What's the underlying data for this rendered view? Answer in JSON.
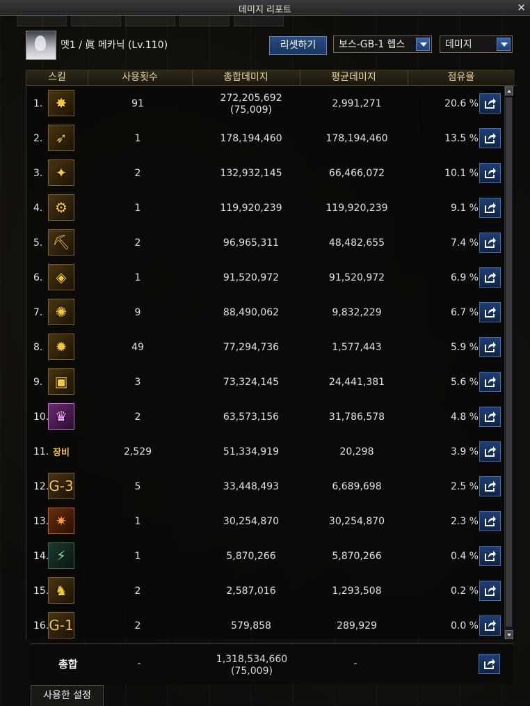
{
  "window": {
    "title": "데미지 리포트",
    "close_icon": "close-icon"
  },
  "header": {
    "character": "멧1 / 眞 메카닉 (Lv.110)",
    "reset_label": "리셋하기",
    "target_select": "보스-GB-1 헵스",
    "mode_select": "데미지"
  },
  "columns": [
    "스킬",
    "사용횟수",
    "총합데미지",
    "평균데미지",
    "점유율"
  ],
  "rows": [
    {
      "rank": "1.",
      "icon": "explosion-skill-icon",
      "uses": "91",
      "total": "272,205,692",
      "total_sub": "(75,009)",
      "avg": "2,991,271",
      "share": "20.6 %"
    },
    {
      "rank": "2.",
      "icon": "missile-skill-icon",
      "uses": "1",
      "total": "178,194,460",
      "total_sub": "",
      "avg": "178,194,460",
      "share": "13.5 %"
    },
    {
      "rank": "3.",
      "icon": "rocket-skill-icon",
      "uses": "2",
      "total": "132,932,145",
      "total_sub": "",
      "avg": "66,466,072",
      "share": "10.1 %"
    },
    {
      "rank": "4.",
      "icon": "mech-skill-icon",
      "uses": "1",
      "total": "119,920,239",
      "total_sub": "",
      "avg": "119,920,239",
      "share": "9.1 %"
    },
    {
      "rank": "5.",
      "icon": "drill-skill-icon",
      "uses": "2",
      "total": "96,965,311",
      "total_sub": "",
      "avg": "48,482,655",
      "share": "7.4 %"
    },
    {
      "rank": "6.",
      "icon": "robot-skill-icon",
      "uses": "1",
      "total": "91,520,972",
      "total_sub": "",
      "avg": "91,520,972",
      "share": "6.9 %"
    },
    {
      "rank": "7.",
      "icon": "burst-skill-icon",
      "uses": "9",
      "total": "88,490,062",
      "total_sub": "",
      "avg": "9,832,229",
      "share": "6.7 %"
    },
    {
      "rank": "8.",
      "icon": "blast-skill-icon",
      "uses": "49",
      "total": "77,294,736",
      "total_sub": "",
      "avg": "1,577,443",
      "share": "5.9 %"
    },
    {
      "rank": "9.",
      "icon": "turret-skill-icon",
      "uses": "3",
      "total": "73,324,145",
      "total_sub": "",
      "avg": "24,441,381",
      "share": "5.6 %"
    },
    {
      "rank": "10.",
      "icon": "laser-skill-icon",
      "uses": "2",
      "total": "63,573,156",
      "total_sub": "",
      "avg": "31,786,578",
      "share": "4.8 %"
    },
    {
      "rank": "11.",
      "icon": "equipment-text",
      "uses": "2,529",
      "total": "51,334,919",
      "total_sub": "",
      "avg": "20,298",
      "share": "3.9 %"
    },
    {
      "rank": "12.",
      "icon": "g3-skill-icon",
      "uses": "5",
      "total": "33,448,493",
      "total_sub": "",
      "avg": "6,689,698",
      "share": "2.5 %"
    },
    {
      "rank": "13.",
      "icon": "fire-skill-icon",
      "uses": "1",
      "total": "30,254,870",
      "total_sub": "",
      "avg": "30,254,870",
      "share": "2.3 %"
    },
    {
      "rank": "14.",
      "icon": "green-mech-skill-icon",
      "uses": "1",
      "total": "5,870,266",
      "total_sub": "",
      "avg": "5,870,266",
      "share": "0.4 %"
    },
    {
      "rank": "15.",
      "icon": "mech-suit-skill-icon",
      "uses": "2",
      "total": "2,587,016",
      "total_sub": "",
      "avg": "1,293,508",
      "share": "0.2 %"
    },
    {
      "rank": "16.",
      "icon": "g1-skill-icon",
      "uses": "2",
      "total": "579,858",
      "total_sub": "",
      "avg": "289,929",
      "share": "0.0 %"
    }
  ],
  "icon_glyphs": [
    "✸",
    "➶",
    "✦",
    "⚙",
    "⛏",
    "◈",
    "✺",
    "✹",
    "▣",
    "♛",
    "장비",
    "G-3",
    "✷",
    "⚡",
    "♞",
    "G-1"
  ],
  "equipment_label": "장비",
  "totals": {
    "label": "총합",
    "uses": "-",
    "total": "1,318,534,660",
    "total_sub": "(75,009)",
    "avg": "-"
  },
  "footer": {
    "tab_label": "사용한 설정"
  },
  "colors": {
    "header_text": "#e8d69a",
    "button_blue": "#1e3f73",
    "accent_gold": "#f0c438"
  }
}
